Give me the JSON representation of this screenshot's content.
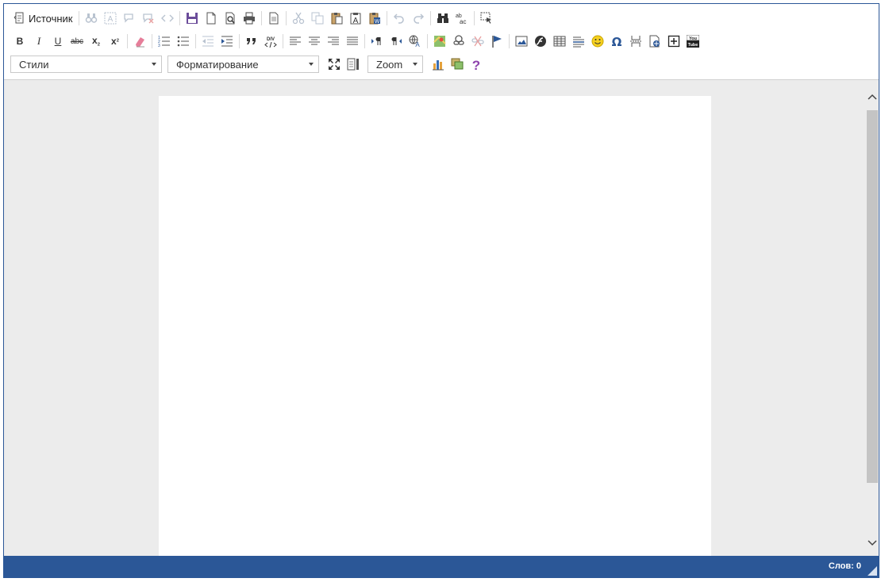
{
  "toolbar": {
    "source_label": "Источник",
    "format_bold": "B",
    "format_italic": "I",
    "format_underline": "U",
    "format_strike": "abc",
    "format_sub": "x",
    "format_sub_mark": "2",
    "format_sup": "x",
    "format_sup_mark": "2",
    "div_label": "DIV",
    "find_label": "ab",
    "find_label2": "ac",
    "youtube_label_top": "You",
    "youtube_label_bottom": "Tube",
    "styles_combo": "Стили",
    "format_combo": "Форматирование",
    "zoom_combo": "Zoom"
  },
  "icons": [
    "source-icon",
    "find-icon",
    "select-all-icon",
    "comment-icon",
    "uncomment-icon",
    "code-icon",
    "save-icon",
    "new-page-icon",
    "preview-icon",
    "print-icon",
    "templates-icon",
    "cut-icon",
    "copy-icon",
    "paste-icon",
    "paste-text-icon",
    "paste-word-icon",
    "undo-icon",
    "redo-icon",
    "find-replace-icon",
    "spellcheck-icon",
    "select-icon",
    "remove-format-icon",
    "numbered-list-icon",
    "bulleted-list-icon",
    "outdent-icon",
    "indent-icon",
    "blockquote-icon",
    "div-icon",
    "align-left-icon",
    "align-center-icon",
    "align-right-icon",
    "justify-icon",
    "ltr-icon",
    "rtl-icon",
    "language-icon",
    "map-icon",
    "link-icon",
    "unlink-icon",
    "anchor-icon",
    "image-icon",
    "flash-icon",
    "table-icon",
    "horizontal-rule-icon",
    "smiley-icon",
    "omega-icon",
    "page-break-icon",
    "iframe-icon",
    "add-icon",
    "youtube-icon",
    "maximize-icon",
    "show-blocks-icon",
    "chart-icon",
    "gallery-icon",
    "help-icon"
  ],
  "colors": {
    "accent": "#2b5797",
    "icon_gray": "#555555",
    "disabled": "#b9c3d0",
    "brand_blue": "#3a6fb5",
    "purple": "#8e44ad"
  },
  "status": {
    "word_count": "Слов: 0"
  }
}
